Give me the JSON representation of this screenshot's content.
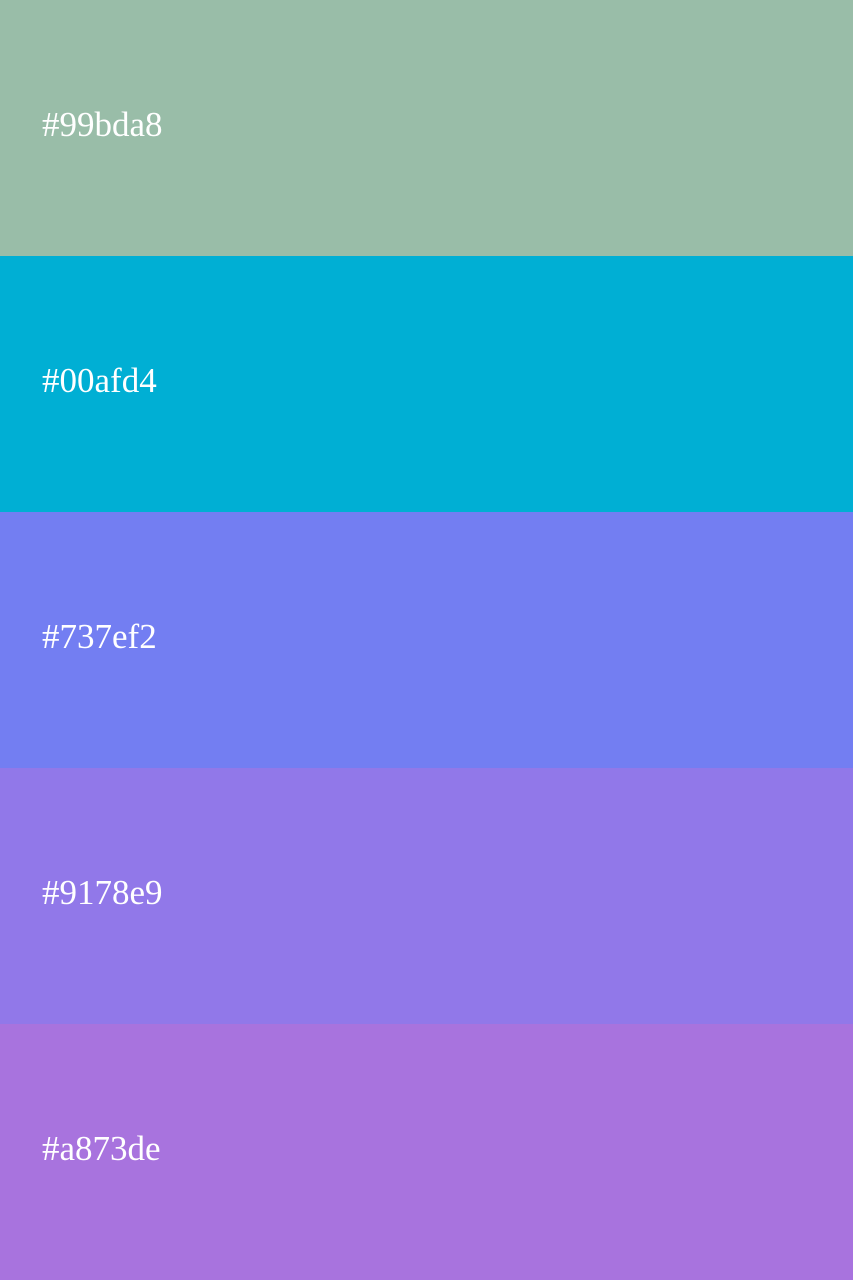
{
  "swatches": [
    {
      "label": "#99bda8",
      "color": "#99bda8"
    },
    {
      "label": "#00afd4",
      "color": "#00afd4"
    },
    {
      "label": "#737ef2",
      "color": "#737ef2"
    },
    {
      "label": "#9178e9",
      "color": "#9178e9"
    },
    {
      "label": "#a873de",
      "color": "#a873de"
    }
  ],
  "text_color": "#ffffff"
}
